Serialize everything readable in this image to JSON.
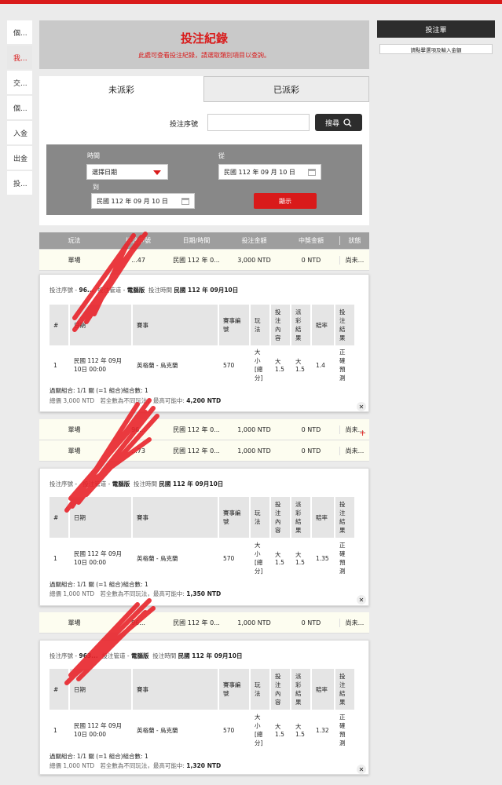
{
  "nav_items": [
    {
      "label": "個...",
      "active": false
    },
    {
      "label": "我...",
      "active": true
    },
    {
      "label": "交...",
      "active": false
    },
    {
      "label": "個...",
      "active": false
    },
    {
      "label": "入金",
      "active": false
    },
    {
      "label": "出金",
      "active": false
    },
    {
      "label": "投...",
      "active": false
    }
  ],
  "header": {
    "title": "投注紀錄",
    "subtitle": "此處可查看投注紀錄，請選取類別項目以查詢。"
  },
  "tabs": {
    "unsettled": "未派彩",
    "settled": "已派彩"
  },
  "search": {
    "serial_label": "投注序號",
    "serial_value": "",
    "search_button": "搜尋"
  },
  "filter": {
    "time_label": "時間",
    "time_value": "選擇日期",
    "from_label": "從",
    "from_value": "民國 112 年 09 月 10 日",
    "to_label": "到",
    "to_value": "民國 112 年 09 月 10 日",
    "show_button": "顯示"
  },
  "summary_headers": [
    "玩法",
    "投注序號",
    "日期/時間",
    "投注金額",
    "中獎金額",
    "狀態"
  ],
  "rows": [
    {
      "play": "單場",
      "serial": "...47",
      "datetime": "民國 112 年 0...",
      "stake": "3,000 NTD",
      "win": "0 NTD",
      "status": "尚未..."
    },
    {
      "play": "單場",
      "serial": "96...",
      "datetime": "民國 112 年 0...",
      "stake": "1,000 NTD",
      "win": "0 NTD",
      "status": "尚未..."
    },
    {
      "play": "單場",
      "serial": "...73",
      "datetime": "民國 112 年 0...",
      "stake": "1,000 NTD",
      "win": "0 NTD",
      "status": "尚未..."
    },
    {
      "play": "單場",
      "serial": "96...",
      "datetime": "民國 112 年 0...",
      "stake": "1,000 NTD",
      "win": "0 NTD",
      "status": "尚未..."
    }
  ],
  "detail_headers": [
    "#",
    "日期",
    "賽事",
    "賽事編號",
    "玩法",
    "投注內容",
    "派彩結果",
    "賠率",
    "投注結果"
  ],
  "details": [
    {
      "meta_prefix": "投注序號 - ",
      "serial": "96...",
      "channel_label": "投注管道 -",
      "channel": "電腦版",
      "time_label": "投注時間",
      "time": "民國 112 年 09月10日",
      "idx": "1",
      "date": "民國 112 年 09月 10日 00:00",
      "match": "英格蘭 - 烏克蘭",
      "match_no": "570",
      "play": "大小[總分]",
      "content": "大 1.5",
      "result": "大 1.5",
      "odds": "1.4",
      "outcome": "正確預測",
      "combo": "過關組合: 1/1 關 (=1 組合)組合數: 1",
      "stake_label": "總價",
      "stake": "3,000 NTD",
      "note": "若全數為不同玩法，最高可能中:",
      "max_win": "4,200 NTD"
    },
    {
      "meta_prefix": "投注序號 - ",
      "serial": "",
      "channel_label": "投注管道 -",
      "channel": "電腦版",
      "time_label": "投注時間",
      "time": "民國 112 年 09月10日",
      "idx": "1",
      "date": "民國 112 年 09月 10日 00:00",
      "match": "英格蘭 - 烏克蘭",
      "match_no": "570",
      "play": "大小[總分]",
      "content": "大 1.5",
      "result": "大 1.5",
      "odds": "1.35",
      "outcome": "正確預測",
      "combo": "過關組合: 1/1 關 (=1 組合)組合數: 1",
      "stake_label": "總價",
      "stake": "1,000 NTD",
      "note": "若全數為不同玩法，最高可能中:",
      "max_win": "1,350 NTD"
    },
    {
      "meta_prefix": "投注序號 - ",
      "serial": "963...",
      "channel_label": "投注管道 -",
      "channel": "電腦版",
      "time_label": "投注時間",
      "time": "民國 112 年 09月10日",
      "idx": "1",
      "date": "民國 112 年 09月 10日 00:00",
      "match": "英格蘭 - 烏克蘭",
      "match_no": "570",
      "play": "大小[總分]",
      "content": "大 1.5",
      "result": "大 1.5",
      "odds": "1.32",
      "outcome": "正確預測",
      "combo": "過關組合: 1/1 關 (=1 組合)組合數: 1",
      "stake_label": "總價",
      "stake": "1,000 NTD",
      "note": "若全數為不同玩法，最高可能中:",
      "max_win": "1,320 NTD"
    }
  ],
  "betslip": {
    "title": "投注單",
    "hint": "請點擊選項及輸入金額"
  },
  "colors": {
    "accent": "#d91a1a",
    "dark": "#2d2d2d",
    "header_gray": "#c9c9c9",
    "row_bg": "#fdfdf0"
  }
}
